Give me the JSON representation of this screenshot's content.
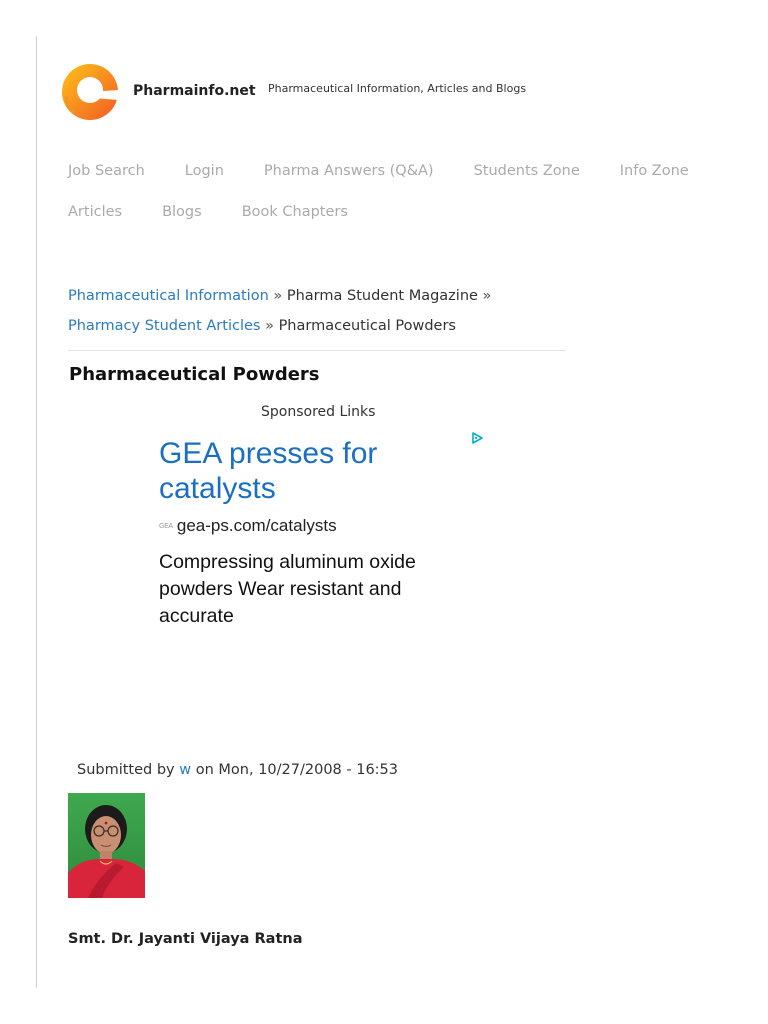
{
  "site": {
    "name": "Pharmainfo.net",
    "tagline": "Pharmaceutical Information, Articles and Blogs",
    "logo_colors": [
      "#f7a81b",
      "#f15a24"
    ]
  },
  "nav": {
    "row1": [
      "Job Search",
      "Login",
      "Pharma Answers (Q&A)",
      "Students Zone",
      "Info Zone"
    ],
    "row2": [
      "Articles",
      "Blogs",
      "Book Chapters"
    ]
  },
  "breadcrumb": {
    "items": [
      {
        "label": "Pharmaceutical Information",
        "link": true
      },
      {
        "label": "Pharma Student Magazine",
        "link": false
      },
      {
        "label": "Pharmacy Student Articles",
        "link": true
      },
      {
        "label": "Pharmaceutical Powders",
        "link": false
      }
    ],
    "separator": "»"
  },
  "page_title": "Pharmaceutical Powders",
  "sponsored_label": "Sponsored Links",
  "ad": {
    "headline": "GEA presses for catalysts",
    "favicon_text": "GEA",
    "url": "gea-ps.com/catalysts",
    "description": "Compressing aluminum oxide powders Wear resistant and accurate",
    "choice_icon": "adchoices-play-icon",
    "link_color": "#1a6fc2"
  },
  "submitted": {
    "prefix": "Submitted by",
    "user": "w",
    "middle": "on",
    "date": "Mon, 10/27/2008 - 16:53"
  },
  "author": {
    "name": "Smt. Dr. Jayanti Vijaya Ratna"
  }
}
